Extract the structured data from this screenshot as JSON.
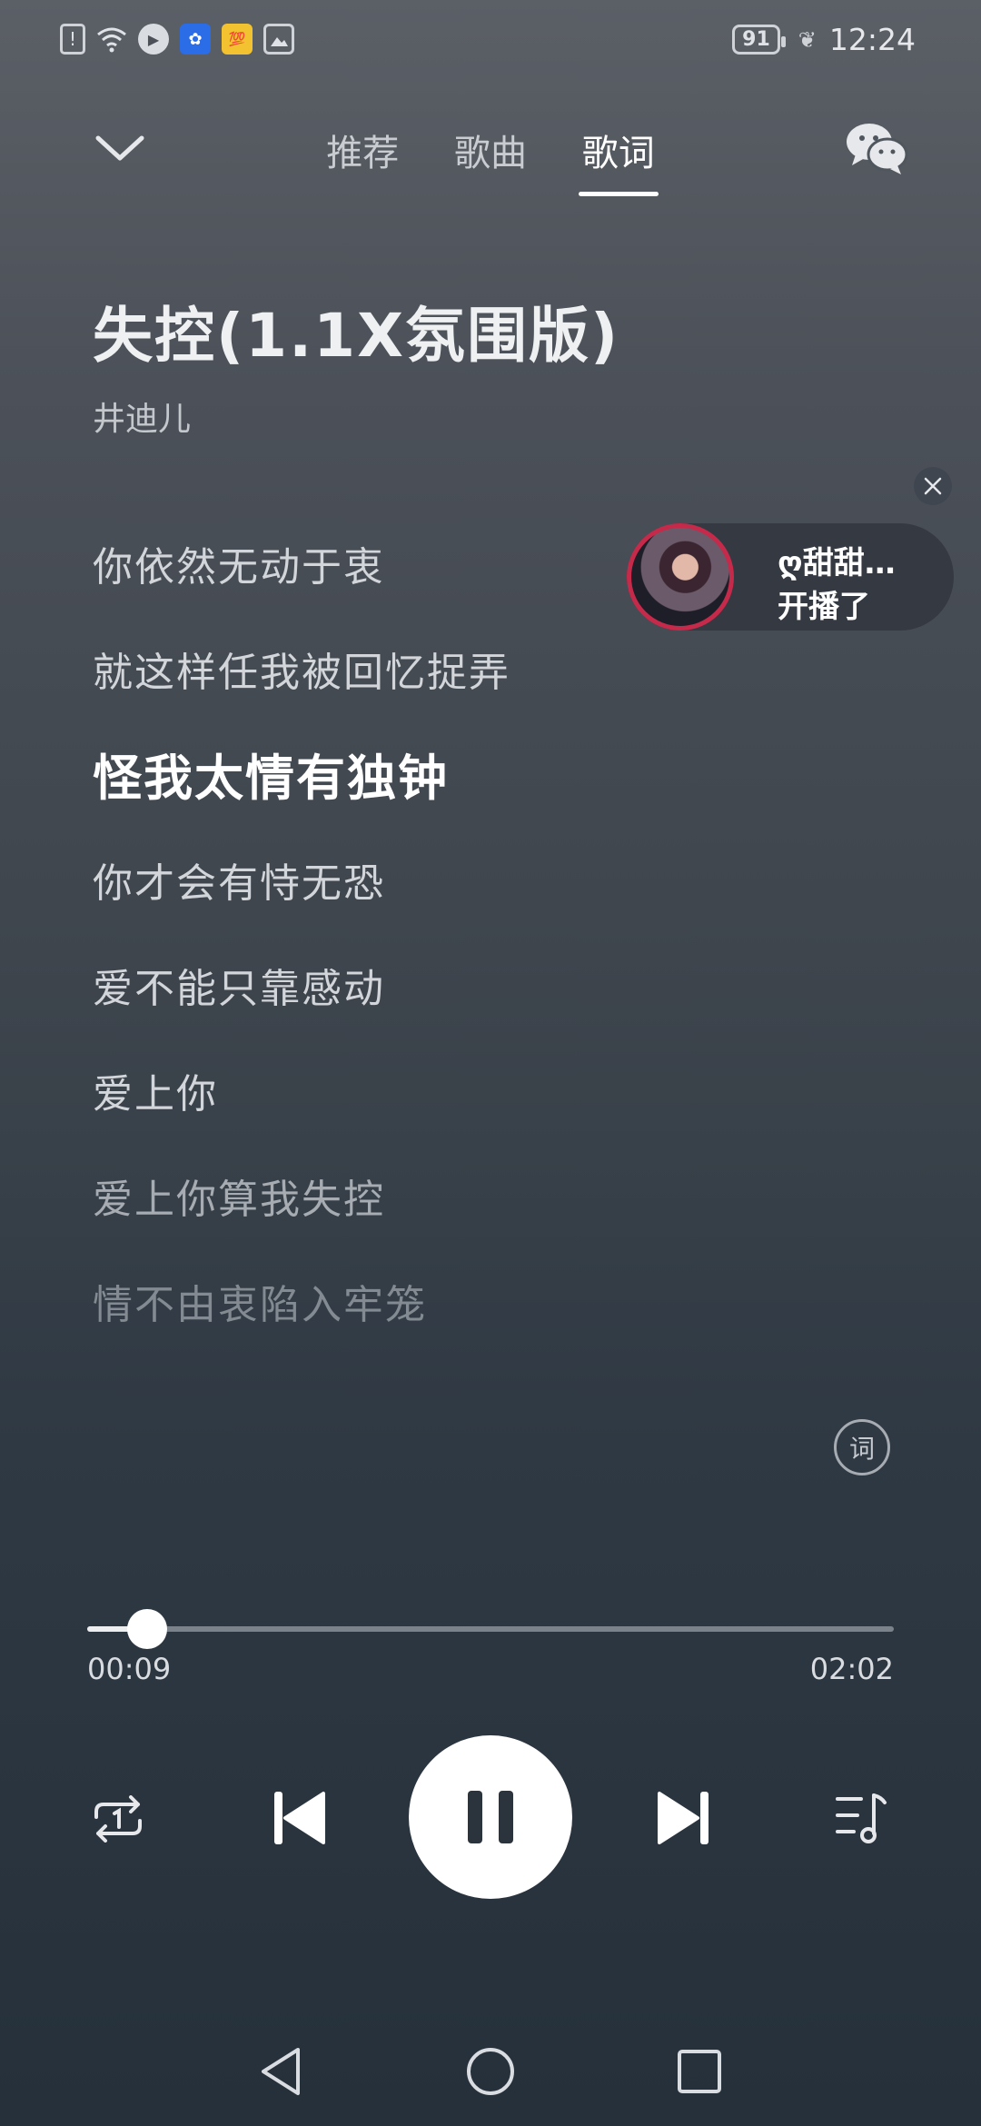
{
  "status_bar": {
    "battery": "91",
    "time": "12:24",
    "icons": [
      "sim-alert-icon",
      "wifi-icon",
      "play-icon",
      "baidu-icon",
      "hundred-icon",
      "image-alert-icon",
      "leaf-icon"
    ]
  },
  "header": {
    "tabs": [
      {
        "label": "推荐",
        "active": false
      },
      {
        "label": "歌曲",
        "active": false
      },
      {
        "label": "歌词",
        "active": true
      }
    ]
  },
  "song": {
    "title": "失控(1.1X氛围版)",
    "artist": "井迪儿"
  },
  "lyrics": [
    "你依然无动于衷",
    "就这样任我被回忆捉弄",
    "怪我太情有独钟",
    "你才会有恃无恐",
    "爱不能只靠感动",
    "爱上你",
    "爱上你算我失控",
    "情不由衷陷入牢笼"
  ],
  "current_lyric_index": 2,
  "live_widget": {
    "name": "ღ甜甜…",
    "status": "开播了"
  },
  "lyric_toggle_label": "词",
  "playback": {
    "current_time": "00:09",
    "duration": "02:02",
    "progress_fraction": 0.074
  },
  "colors": {
    "accent_ring": "#c52a4a",
    "active_text": "#ffffff"
  }
}
